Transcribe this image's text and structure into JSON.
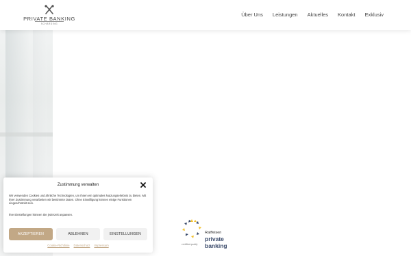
{
  "header": {
    "logo_title": "PRIVATE BANKING",
    "logo_subtitle": "SCHÄRDING",
    "nav": [
      "Über Uns",
      "Leistungen",
      "Aktuelles",
      "Kontakt",
      "Exklusiv"
    ]
  },
  "badge": {
    "raiffeisen": "Raiffeisen",
    "line1": "private",
    "line2": "banking",
    "certified": "certified quality"
  },
  "consent": {
    "title": "Zustimmung verwalten",
    "text": "Wir verwenden Cookies und ähnliche Technologien, um Ihnen ein optimales Nutzungserlebnis zu bieten. Mit Ihrer Zustimmung verarbeiten wir bestimmte Daten. Ohne Einwilligung können einige Funktionen eingeschränkt sein.",
    "text2": "Ihre Einstellungen können Sie jederzeit anpassen.",
    "accept_label": "AKZEPTIEREN",
    "decline_label": "ABLEHNEN",
    "settings_label": "EINSTELLUNGEN",
    "links": [
      "Cookie-Richtlinie",
      "Datenschutz",
      "Impressum"
    ]
  },
  "colors": {
    "accent": "#c2a886",
    "nav_text": "#444444",
    "badge_blue": "#3a4a6a",
    "badge_yellow": "#f2c230"
  },
  "icons": {
    "logo": "crossed-keys-icon",
    "close": "close-icon",
    "badge": "star-ring-icon"
  }
}
